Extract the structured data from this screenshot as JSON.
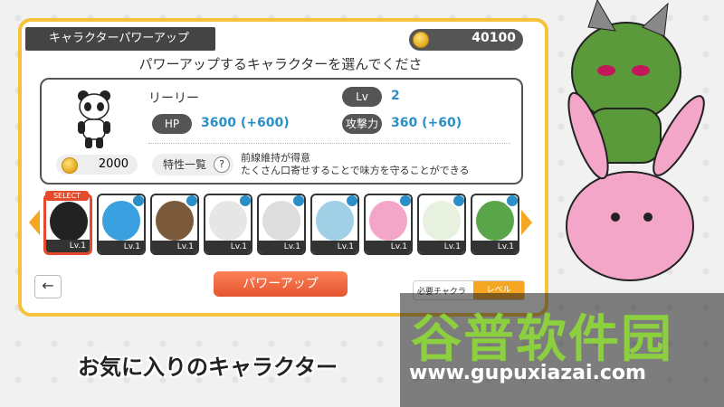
{
  "header": {
    "title": "キャラクターパワーアップ",
    "coins": "40100"
  },
  "prompt": "パワーアップするキャラクターを選んでください",
  "character": {
    "name": "リーリー",
    "cost": "2000",
    "hp_label": "HP",
    "hp_value": "3600 (+600)",
    "lv_label": "Lv",
    "lv_value": "2",
    "atk_label": "攻撃力",
    "atk_value": "360 (+60)",
    "trait_label": "特性一覧",
    "trait_help": "?",
    "trait_line1": "前線維持が得意",
    "trait_line2": "たくさん口寄せすることで味方を守ることができる"
  },
  "roster": {
    "select_tag": "SELECT",
    "cards": [
      {
        "lv": "Lv.1",
        "color": "#222222"
      },
      {
        "lv": "Lv.1",
        "color": "#3aa0e0"
      },
      {
        "lv": "Lv.1",
        "color": "#7a5a3a"
      },
      {
        "lv": "Lv.1",
        "color": "#e6e6e6"
      },
      {
        "lv": "Lv.1",
        "color": "#dddddd"
      },
      {
        "lv": "Lv.1",
        "color": "#9fd0e6"
      },
      {
        "lv": "Lv.1",
        "color": "#f4a6c8"
      },
      {
        "lv": "Lv.1",
        "color": "#e8f0e0"
      },
      {
        "lv": "Lv.1",
        "color": "#5aa44a"
      }
    ]
  },
  "buttons": {
    "back": "←",
    "power_up": "パワーアップ"
  },
  "requirement": {
    "a": "必要チャクラ",
    "b": "レベル"
  },
  "banner": "お気に入りのキャラクター",
  "watermark": {
    "title": "谷普软件园",
    "url": "www.gupuxiazai.com"
  }
}
